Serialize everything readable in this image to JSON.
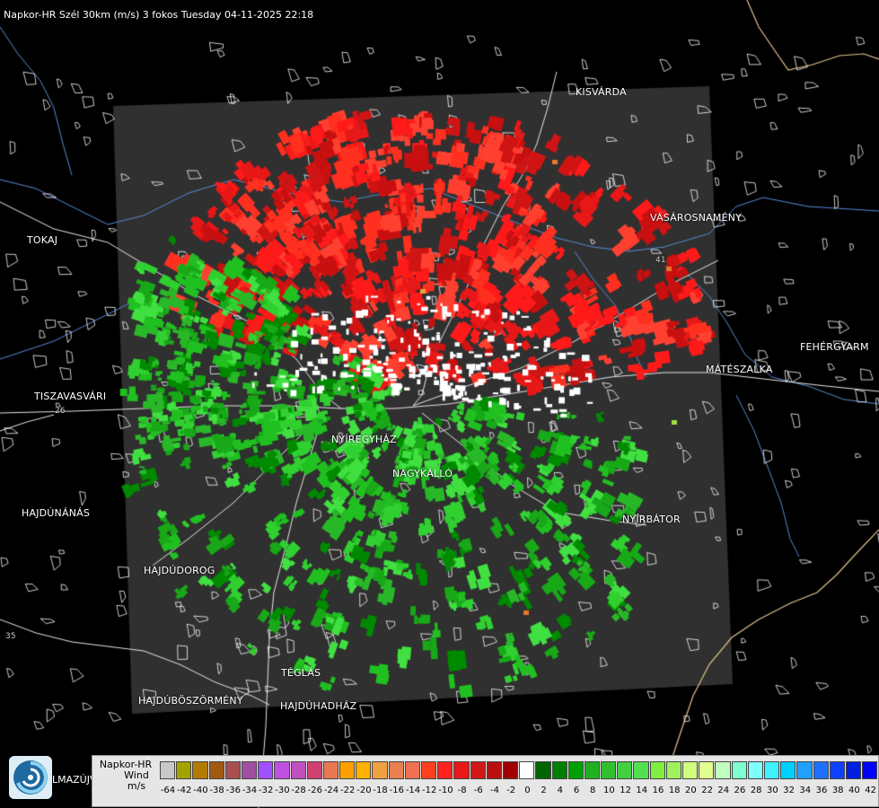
{
  "header": {
    "title": "Napkor-HR Szél 30km (m/s) 3 fokos Tuesday 04-11-2025 22:18"
  },
  "cities": [
    {
      "name": "KISVÁRDA"
    },
    {
      "name": "TOKAJ"
    },
    {
      "name": "VÁSÁROSNAMÉNY"
    },
    {
      "name": "FEHÉRGYARM"
    },
    {
      "name": "MÁTÉSZALKA"
    },
    {
      "name": "TISZAVASVÁRI"
    },
    {
      "name": "NYÍREGYHÁZ"
    },
    {
      "name": "NAGYKÁLLÓ"
    },
    {
      "name": "HAJDÚNÁNÁS"
    },
    {
      "name": "NYÍRBÁTOR"
    },
    {
      "name": "HAJDÚDOROG"
    },
    {
      "name": "TÉGLÁS"
    },
    {
      "name": "HAJDÚBÖSZÖRMÉNY"
    },
    {
      "name": "HAJDÚHADHÁZ"
    }
  ],
  "roads": [
    "26",
    "35",
    "41"
  ],
  "legend": {
    "title_line1": "Napkor-HR",
    "title_line2": "Wind",
    "unit": "m/s",
    "values": [
      "-64",
      "-42",
      "-40",
      "-38",
      "-36",
      "-34",
      "-32",
      "-30",
      "-28",
      "-26",
      "-24",
      "-22",
      "-20",
      "-18",
      "-16",
      "-14",
      "-12",
      "-10",
      "-8",
      "-6",
      "-4",
      "-2",
      "0",
      "2",
      "4",
      "6",
      "8",
      "10",
      "12",
      "14",
      "16",
      "18",
      "20",
      "22",
      "24",
      "26",
      "28",
      "30",
      "32",
      "34",
      "36",
      "38",
      "40",
      "42"
    ],
    "colors": [
      "#c8c8c8",
      "#a3a300",
      "#b37a00",
      "#a05a10",
      "#a85050",
      "#a050a0",
      "#a050ff",
      "#c050e0",
      "#c050c0",
      "#d04070",
      "#e87850",
      "#ffa000",
      "#ffb000",
      "#f0a040",
      "#e88050",
      "#f07050",
      "#ff4020",
      "#ff2020",
      "#e81818",
      "#d01818",
      "#b81010",
      "#a00000",
      "#ffffff",
      "#006400",
      "#008000",
      "#00a000",
      "#20b020",
      "#30c030",
      "#40d040",
      "#50e050",
      "#80f040",
      "#a0f060",
      "#d0ff80",
      "#e0ff90",
      "#c0ffc0",
      "#80ffd0",
      "#80ffff",
      "#40f0ff",
      "#00d0ff",
      "#20a0ff",
      "#2070ff",
      "#1040ff",
      "#0020e0",
      "#0000ff"
    ]
  },
  "logo": {
    "name": "swirl-logo",
    "partial_text": "LMAZÚJVÁR"
  },
  "radar": {
    "approaching_color": "#ff1a1a",
    "receding_color": "#22c922",
    "coverage_color": "#303030"
  }
}
